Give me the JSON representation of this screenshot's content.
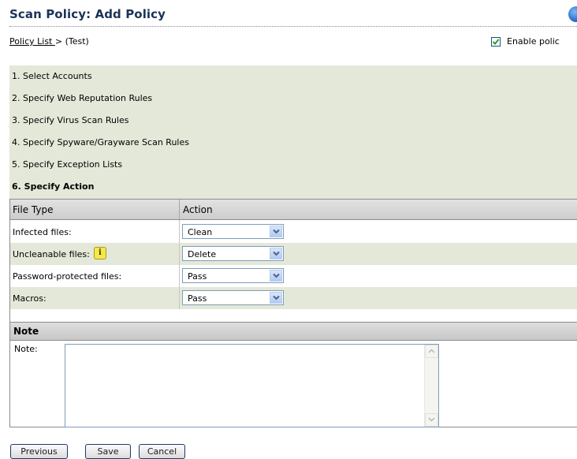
{
  "page": {
    "title": "Scan Policy: Add Policy",
    "help_icon": "help-icon",
    "breadcrumb": {
      "link": "Policy List ",
      "separator": ">",
      "current": "(Test)"
    },
    "enable_policy": {
      "label": "Enable polic",
      "checked": true
    }
  },
  "steps": [
    {
      "label": "1. Select Accounts",
      "active": false
    },
    {
      "label": "2. Specify Web Reputation Rules",
      "active": false
    },
    {
      "label": "3. Specify Virus Scan Rules",
      "active": false
    },
    {
      "label": "4. Specify Spyware/Grayware Scan Rules",
      "active": false
    },
    {
      "label": "5. Specify Exception Lists",
      "active": false
    },
    {
      "label": "6. Specify Action",
      "active": true
    }
  ],
  "action_table": {
    "headers": {
      "file_type": "File Type",
      "action": "Action"
    },
    "rows": [
      {
        "file_type": "Infected files:",
        "action": "Clean"
      },
      {
        "file_type": "Uncleanable files:",
        "action": "Delete",
        "info_icon": "i"
      },
      {
        "file_type": "Password-protected files:",
        "action": "Pass"
      },
      {
        "file_type": "Macros:",
        "action": "Pass"
      }
    ]
  },
  "note": {
    "section_title": "Note",
    "label": "Note:",
    "value": ""
  },
  "buttons": {
    "previous": "Previous",
    "save": "Save",
    "cancel": "Cancel"
  },
  "colors": {
    "title": "#1b3357",
    "step_background": "#e4e8d8",
    "table_header": "#d6d6d6",
    "button_border": "#1b3a6b"
  }
}
